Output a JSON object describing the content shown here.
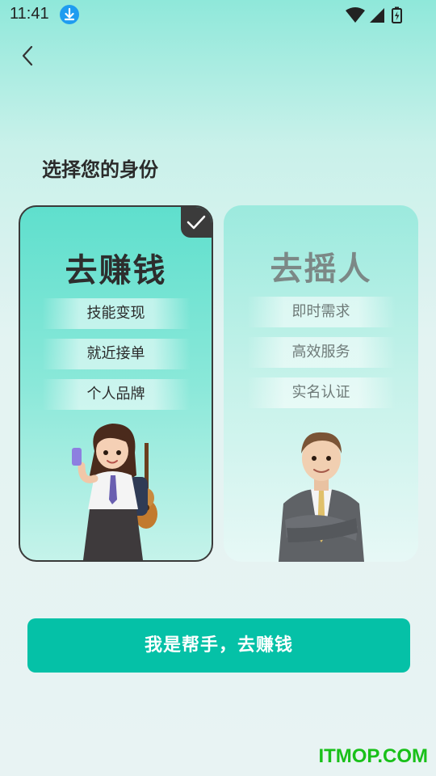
{
  "status_bar": {
    "time": "11:41",
    "download_icon": "download-arrow-icon",
    "wifi_icon": "wifi-icon",
    "signal_icon": "signal-icon",
    "battery_icon": "battery-charging-icon"
  },
  "nav": {
    "back_icon": "chevron-left-icon"
  },
  "heading": "选择您的身份",
  "cards": [
    {
      "title": "去赚钱",
      "tags": [
        "技能变现",
        "就近接单",
        "个人品牌"
      ],
      "selected": true,
      "illustration": "woman-with-phone-and-guitar"
    },
    {
      "title": "去摇人",
      "tags": [
        "即时需求",
        "高效服务",
        "实名认证"
      ],
      "selected": false,
      "illustration": "man-in-suit-arms-crossed"
    }
  ],
  "cta": {
    "label": "我是帮手，去赚钱"
  },
  "watermark": "ITMOP.COM",
  "colors": {
    "primary": "#05c1a7",
    "card_selected_border": "#3a3a3a",
    "watermark": "#19c019"
  }
}
